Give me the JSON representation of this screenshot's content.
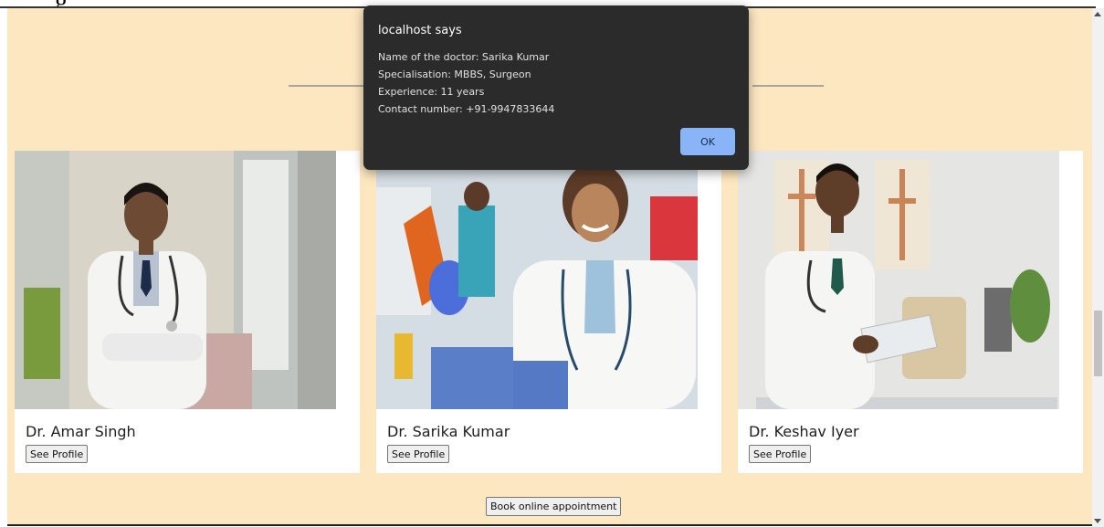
{
  "page": {
    "top_fragment": "g",
    "colors": {
      "page_bg": "#fde7c1",
      "card_bg": "#ffffff",
      "dialog_bg": "#2b2b2b",
      "ok_button": "#8ab4f8"
    }
  },
  "doctors": [
    {
      "name": "Dr. Amar Singh",
      "profile_label": "See Profile",
      "photo_icon": "doctor-photo-icon"
    },
    {
      "name": "Dr. Sarika Kumar",
      "profile_label": "See Profile",
      "photo_icon": "doctor-photo-icon"
    },
    {
      "name": "Dr. Keshav Iyer",
      "profile_label": "See Profile",
      "photo_icon": "doctor-photo-icon"
    }
  ],
  "book_button": "Book online appointment",
  "alert": {
    "title": "localhost says",
    "lines": [
      "Name of the doctor: Sarika Kumar",
      "Specialisation: MBBS, Surgeon",
      "Experience: 11 years",
      "Contact number: +91-9947833644"
    ],
    "ok_label": "OK"
  }
}
